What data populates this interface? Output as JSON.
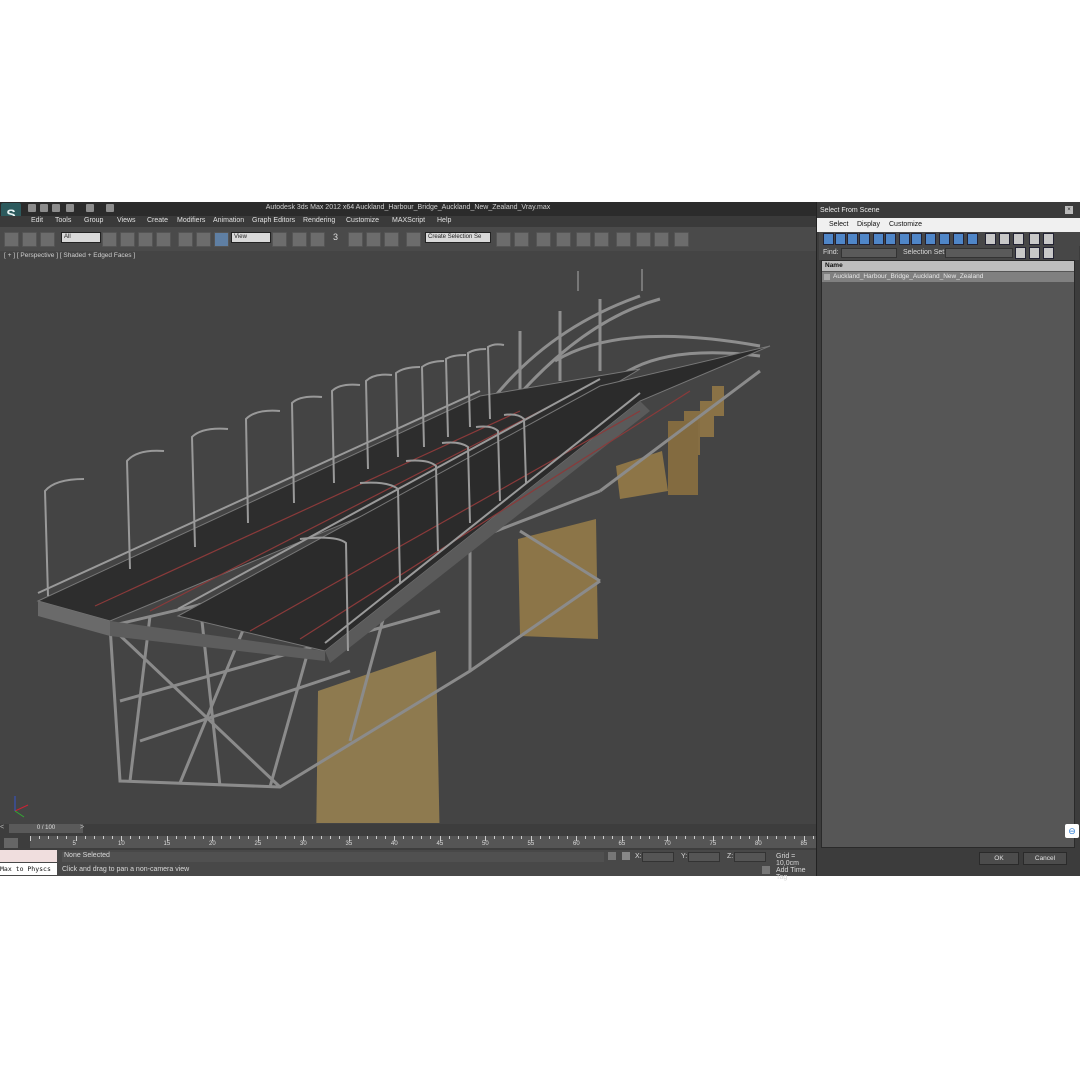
{
  "app": {
    "window_title": "Autodesk 3ds Max  2012 x64     Auckland_Harbour_Bridge_Auckland_New_Zealand_Vray.max",
    "menu": [
      "Edit",
      "Tools",
      "Group",
      "Views",
      "Create",
      "Modifiers",
      "Animation",
      "Graph Editors",
      "Rendering",
      "Customize",
      "MAXScript",
      "Help"
    ]
  },
  "toolbar": {
    "filter_value": "All",
    "refcoord_value": "View",
    "snap_label": "3",
    "selection_set_placeholder": "Create Selection Se"
  },
  "viewport": {
    "label": "[ + ] [ Perspective ] [ Shaded + Edged Faces ]"
  },
  "timeline": {
    "frame": "0 / 100",
    "ticks": [
      "5",
      "10",
      "15",
      "20",
      "25",
      "30",
      "35",
      "40",
      "45",
      "50",
      "55",
      "60",
      "65",
      "70",
      "75",
      "80",
      "85"
    ]
  },
  "status": {
    "selection": "None Selected",
    "prompt": "Click and drag to pan a non-camera view",
    "x_label": "X:",
    "y_label": "Y:",
    "z_label": "Z:",
    "grid": "Grid = 10,0cm",
    "add_time_tag": "Add Time Tag",
    "maxscript_listener": "Max to Physcs"
  },
  "dialog": {
    "title": "Select From Scene",
    "menu": [
      "Select",
      "Display",
      "Customize"
    ],
    "find_label": "Find:",
    "selection_set_label": "Selection Set:",
    "column_name": "Name",
    "items": [
      "Auckland_Harbour_Bridge_Auckland_New_Zealand"
    ],
    "ok": "OK",
    "cancel": "Cancel"
  }
}
